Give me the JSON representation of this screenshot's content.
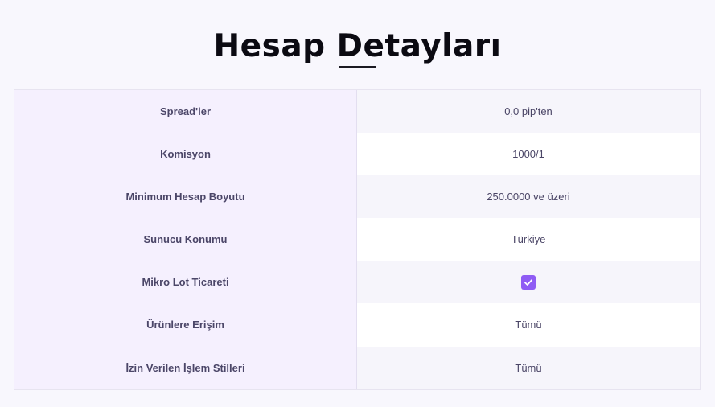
{
  "page": {
    "title": "Hesap Detayları"
  },
  "account_details": {
    "rows": [
      {
        "label": "Spread'ler",
        "value": "0,0 pip'ten"
      },
      {
        "label": "Komisyon",
        "value": "1000/1"
      },
      {
        "label": "Minimum Hesap Boyutu",
        "value": "250.0000 ve üzeri"
      },
      {
        "label": "Sunucu Konumu",
        "value": "Türkiye"
      },
      {
        "label": "Mikro Lot Ticareti",
        "value_icon": "checkmark-checkbox-icon",
        "checked": true
      },
      {
        "label": "Ürünlere Erişim",
        "value": "Tümü"
      },
      {
        "label": "İzin Verilen İşlem Stilleri",
        "value": "Tümü"
      }
    ]
  },
  "colors": {
    "accent": "#8f5cf4",
    "label_column_bg": "#f5f0fe",
    "title": "#0b0a12",
    "text": "#4a4566"
  }
}
